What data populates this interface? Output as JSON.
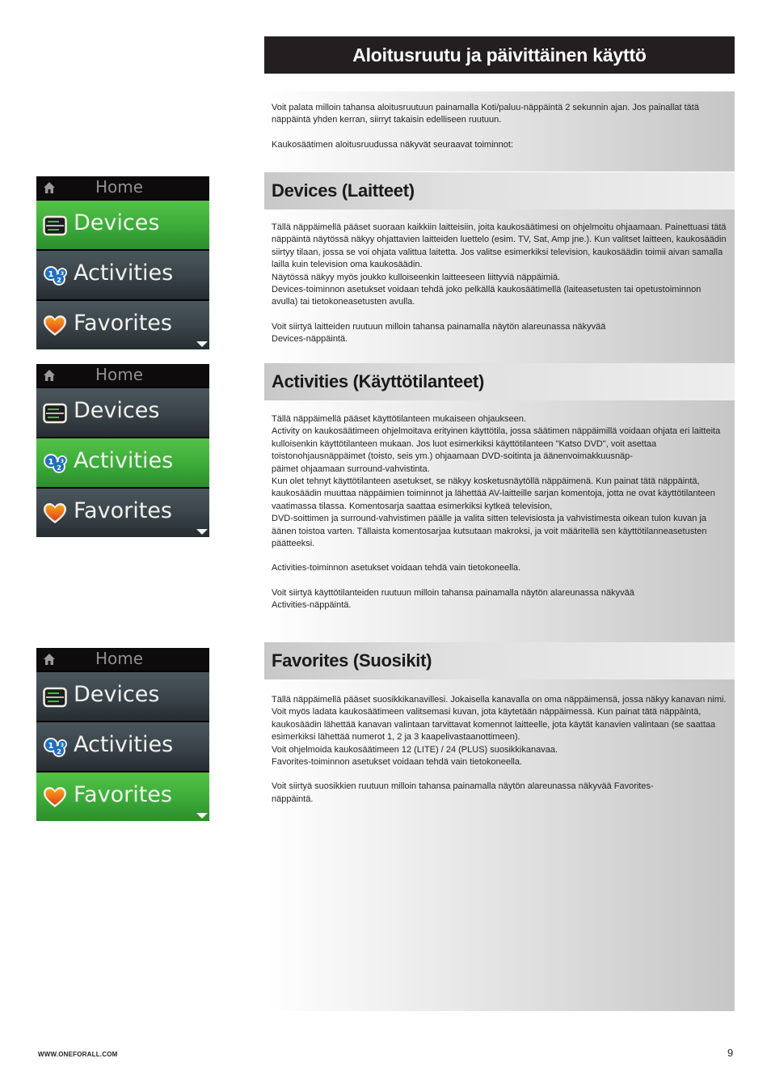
{
  "page": {
    "title": "Aloitusruutu ja päivittäinen käyttö",
    "footer_url": "WWW.ONEFORALL.COM",
    "page_number": "9"
  },
  "intro": {
    "paragraphs": [
      "Voit palata milloin tahansa aloitusruutuun painamalla Koti/paluu-näppäintä 2 sekunnin ajan. Jos painallat tätä näppäintä yhden kerran, siirryt takaisin edelliseen ruutuun.",
      "Kaukosäätimen aloitusruudussa näkyvät seuraavat toiminnot:"
    ]
  },
  "sections": [
    {
      "heading": "Devices (Laitteet)",
      "paragraphs": [
        "Tällä näppäimellä pääset suoraan kaikkiin laitteisiin, joita kaukosäätimesi on ohjelmoitu ohjaamaan. Painettuasi tätä näppäintä näytössä näkyy ohjattavien laitteiden luettelo (esim. TV, Sat, Amp jne.). Kun valitset laitteen, kaukosäädin siirtyy tilaan, jossa se voi ohjata valittua laitetta. Jos valitse esimerkiksi television, kaukosäädin toimii aivan samalla lailla kuin television oma kaukosäädin.\nNäytössä näkyy myös joukko kulloiseenkin laitteeseen liittyviä näppäimiä.\nDevices-toiminnon asetukset voidaan tehdä joko pelkällä kaukosäätimellä (laiteasetusten tai opetustoiminnon avulla) tai tietokoneasetusten avulla.",
        "Voit siirtyä laitteiden ruutuun milloin tahansa painamalla näytön alareunassa näkyvää\nDevices-näppäintä."
      ]
    },
    {
      "heading": "Activities (Käyttötilanteet)",
      "paragraphs": [
        "Tällä näppäimellä pääset käyttötilanteen mukaiseen ohjaukseen.\nActivity on kaukosäätimeen ohjelmoitava erityinen käyttötila, jossa säätimen näppäimillä voidaan ohjata eri laitteita kulloisenkin käyttötilanteen mukaan. Jos luot esimerkiksi käyttötilanteen \"Katso DVD\", voit asettaa toistonohjausnäppäimet (toisto, seis ym.) ohjaamaan DVD-soitinta ja äänenvoimakkuusnäp-\npäimet ohjaamaan surround-vahvistinta.\n Kun olet tehnyt käyttötilanteen asetukset, se näkyy kosketusnäytöllä näppäimenä. Kun painat tätä näppäintä, kaukosäädin muuttaa näppäimien toiminnot ja lähettää AV-laitteille sarjan komentoja, jotta ne ovat käyttötilanteen vaatimassa tilassa. Komentosarja saattaa esimerkiksi kytkeä television,\nDVD-soittimen ja surround-vahvistimen päälle ja valita sitten televisiosta ja vahvistimesta oikean tulon kuvan ja äänen toistoa varten. Tällaista komentosarjaa kutsutaan makroksi, ja voit määritellä sen käyttötilanneasetusten päätteeksi.",
        "Activities-toiminnon asetukset voidaan tehdä vain tietokoneella.",
        "Voit siirtyä käyttötilanteiden ruutuun milloin tahansa painamalla näytön alareunassa näkyvää\nActivities-näppäintä."
      ]
    },
    {
      "heading": "Favorites (Suosikit)",
      "paragraphs": [
        "Tällä näppäimellä pääset suosikkikanavillesi. Jokaisella kanavalla on oma näppäimensä, jossa näkyy kanavan nimi. Voit myös ladata kaukosäätimeen valitsemasi kuvan, jota käytetään näppäimessä. Kun painat tätä näppäintä, kaukosäädin lähettää kanavan valintaan tarvittavat komennot laitteelle, jota käytät kanavien valintaan (se saattaa esimerkiksi lähettää numerot 1, 2 ja 3 kaapelivastaanottimeen).\nVoit ohjelmoida kaukosäätimeen 12 (LITE) / 24 (PLUS) suosikkikanavaa.\nFavorites-toiminnon asetukset voidaan tehdä vain tietokoneella.",
        "Voit siirtyä suosikkien ruutuun milloin tahansa painamalla näytön alareunassa näkyvää Favorites-\nnäppäintä."
      ]
    }
  ],
  "screens": [
    {
      "header": "Home",
      "header_icon": "home-icon",
      "selected": "Devices",
      "items": [
        {
          "label": "Devices",
          "icon": "devices-icon"
        },
        {
          "label": "Activities",
          "icon": "activities-icon"
        },
        {
          "label": "Favorites",
          "icon": "favorites-heart-icon"
        }
      ],
      "scroll_indicator": "down-arrow-icon"
    },
    {
      "header": "Home",
      "header_icon": "home-icon",
      "selected": "Activities",
      "items": [
        {
          "label": "Devices",
          "icon": "devices-icon"
        },
        {
          "label": "Activities",
          "icon": "activities-icon"
        },
        {
          "label": "Favorites",
          "icon": "favorites-heart-icon"
        }
      ],
      "scroll_indicator": "down-arrow-icon"
    },
    {
      "header": "Home",
      "header_icon": "home-icon",
      "selected": "Favorites",
      "items": [
        {
          "label": "Devices",
          "icon": "devices-icon"
        },
        {
          "label": "Activities",
          "icon": "activities-icon"
        },
        {
          "label": "Favorites",
          "icon": "favorites-heart-icon"
        }
      ],
      "scroll_indicator": "down-arrow-icon"
    }
  ],
  "colors": {
    "title_bar_bg": "#231f20",
    "selected_row": "#3cae3a",
    "unselected_row": "#3b454b"
  }
}
